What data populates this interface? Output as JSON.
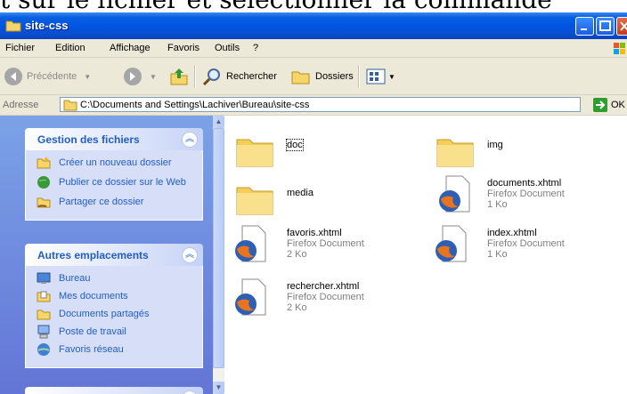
{
  "top_text": "t sur le fichier et sélectionner la commande",
  "window": {
    "title": "site-css"
  },
  "menu": {
    "items": [
      "Fichier",
      "Edition",
      "Affichage",
      "Favoris",
      "Outils",
      "?"
    ]
  },
  "toolbar": {
    "back_label": "Précédente",
    "search_label": "Rechercher",
    "folders_label": "Dossiers"
  },
  "address": {
    "label": "Adresse",
    "path": "C:\\Documents and Settings\\Lachiver\\Bureau\\site-css",
    "go_label": "OK"
  },
  "taskpane": {
    "file_tasks": {
      "title": "Gestion des fichiers",
      "items": [
        "Créer un nouveau dossier",
        "Publier ce dossier sur le Web",
        "Partager ce dossier"
      ]
    },
    "other_places": {
      "title": "Autres emplacements",
      "items": [
        "Bureau",
        "Mes documents",
        "Documents partagés",
        "Poste de travail",
        "Favoris réseau"
      ]
    }
  },
  "files": [
    {
      "name": "doc",
      "kind": "folder"
    },
    {
      "name": "img",
      "kind": "folder"
    },
    {
      "name": "media",
      "kind": "folder"
    },
    {
      "name": "documents.xhtml",
      "type": "Firefox Document",
      "size": "1 Ko"
    },
    {
      "name": "favoris.xhtml",
      "type": "Firefox Document",
      "size": "2 Ko"
    },
    {
      "name": "index.xhtml",
      "type": "Firefox Document",
      "size": "1 Ko"
    },
    {
      "name": "rechercher.xhtml",
      "type": "Firefox Document",
      "size": "2 Ko"
    }
  ],
  "colors": {
    "titlebar": "#0054e3",
    "taskpane_bg": "#7ba2e7",
    "task_link": "#215dc6"
  }
}
